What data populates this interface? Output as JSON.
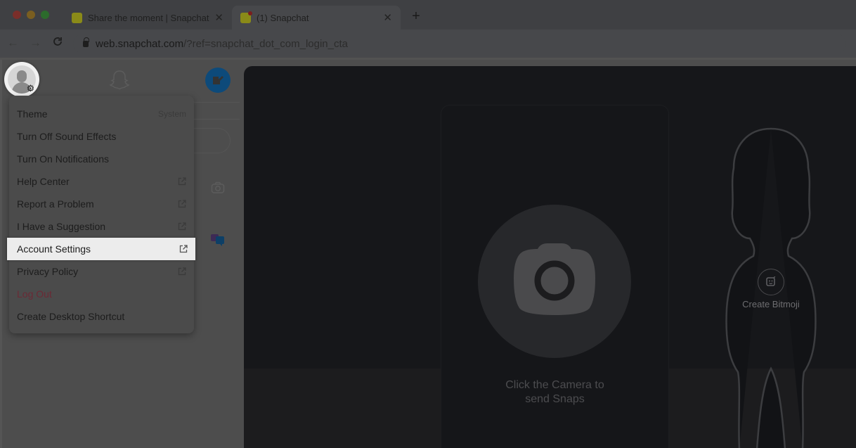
{
  "browser": {
    "tabs": [
      {
        "title": "Share the moment | Snapchat",
        "active": false,
        "close": "✕",
        "favicon": "snapchat-ghost-icon"
      },
      {
        "title": "(1) Snapchat",
        "active": true,
        "close": "✕",
        "favicon": "snapchat-ghost-icon",
        "notification_dot": true
      }
    ],
    "new_tab": "+",
    "nav": {
      "back": "←",
      "forward": "→",
      "reload": "C"
    },
    "url": {
      "host": "web.snapchat.com",
      "rest": "/?ref=snapchat_dot_com_login_cta"
    }
  },
  "sidebar": {
    "avatar_badge": "⚙",
    "icons": [
      "avatar-icon",
      "snapchat-ghost-icon",
      "new-chat-icon",
      "camera-icon",
      "chat-bubbles-icon"
    ],
    "accent_color": "#0d4a7a"
  },
  "menu": {
    "items": [
      {
        "label": "Theme",
        "meta": "System",
        "external": false
      },
      {
        "label": "Turn Off Sound Effects",
        "external": false
      },
      {
        "label": "Turn On Notifications",
        "external": false
      },
      {
        "label": "Help Center",
        "external": true
      },
      {
        "label": "Report a Problem",
        "external": true
      },
      {
        "label": "I Have a Suggestion",
        "external": true
      },
      {
        "label": "Account Settings",
        "external": true,
        "highlighted": true
      },
      {
        "label": "Privacy Policy",
        "external": true
      },
      {
        "label": "Log Out",
        "external": false,
        "danger": true
      },
      {
        "label": "Create Desktop Shortcut",
        "external": false
      }
    ],
    "danger_color": "#6b2935"
  },
  "main": {
    "camera_caption_line1": "Click the Camera to",
    "camera_caption_line2": "send Snaps",
    "bitmoji_label": "Create Bitmoji"
  }
}
